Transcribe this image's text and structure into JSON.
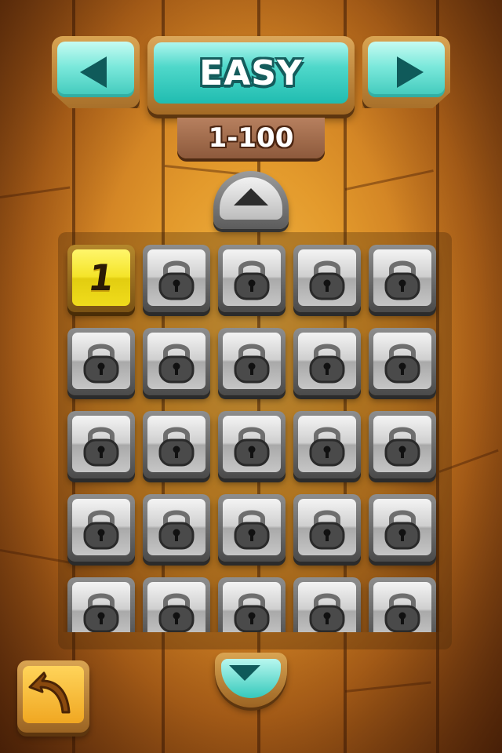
{
  "difficulty": {
    "label": "EASY",
    "range": "1-100"
  },
  "navigation": {
    "prev_icon": "left-arrow-icon",
    "next_icon": "right-arrow-icon",
    "scroll_up_icon": "up-arrow-icon",
    "scroll_down_icon": "down-arrow-icon",
    "back_icon": "back-arrow-icon"
  },
  "levels": [
    {
      "label": "1",
      "locked": false
    },
    {
      "label": "",
      "locked": true
    },
    {
      "label": "",
      "locked": true
    },
    {
      "label": "",
      "locked": true
    },
    {
      "label": "",
      "locked": true
    },
    {
      "label": "",
      "locked": true
    },
    {
      "label": "",
      "locked": true
    },
    {
      "label": "",
      "locked": true
    },
    {
      "label": "",
      "locked": true
    },
    {
      "label": "",
      "locked": true
    },
    {
      "label": "",
      "locked": true
    },
    {
      "label": "",
      "locked": true
    },
    {
      "label": "",
      "locked": true
    },
    {
      "label": "",
      "locked": true
    },
    {
      "label": "",
      "locked": true
    },
    {
      "label": "",
      "locked": true
    },
    {
      "label": "",
      "locked": true
    },
    {
      "label": "",
      "locked": true
    },
    {
      "label": "",
      "locked": true
    },
    {
      "label": "",
      "locked": true
    },
    {
      "label": "",
      "locked": true
    },
    {
      "label": "",
      "locked": true
    },
    {
      "label": "",
      "locked": true
    },
    {
      "label": "",
      "locked": true
    },
    {
      "label": "",
      "locked": true
    }
  ],
  "colors": {
    "teal_button": "#4fd8ca",
    "unlocked_tile": "#f4e429",
    "locked_tile": "#c6c6c6",
    "wood": "#e39a2c"
  }
}
